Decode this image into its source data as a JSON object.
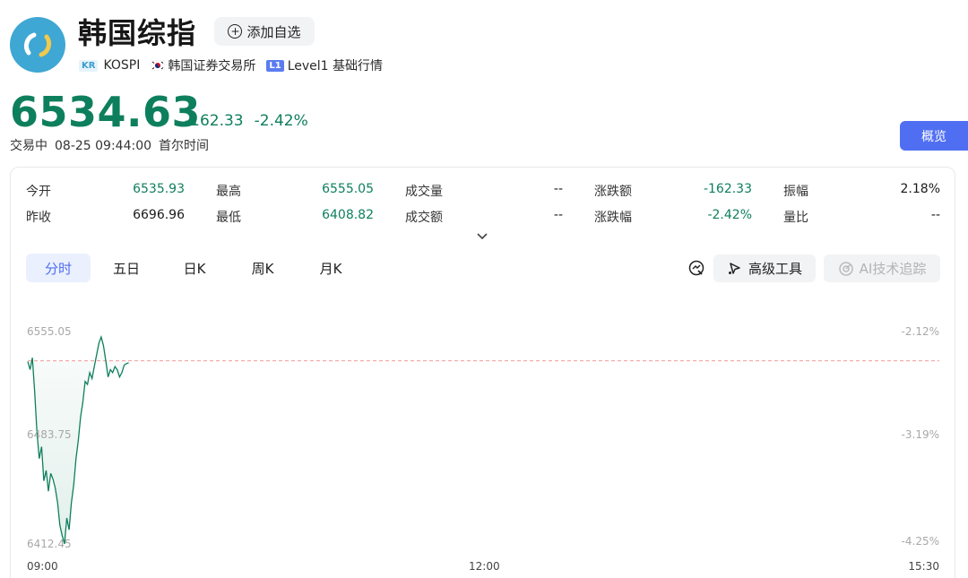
{
  "header": {
    "title": "韩国综指",
    "add_watchlist_label": "添加自选",
    "market_badge": "KR",
    "symbol": "KOSPI",
    "exchange": "韩国证券交易所",
    "level_badge": "L1",
    "level_label": "Level1 基础行情"
  },
  "quote": {
    "price": "6534.63",
    "change": "-162.33",
    "change_pct": "-2.42%",
    "status": "交易中",
    "datetime": "08-25 09:44:00",
    "timezone": "首尔时间",
    "color": "#0e7f5d"
  },
  "overview_button": "概览",
  "stats": {
    "rows": [
      [
        {
          "label": "今开",
          "value": "6535.93",
          "tone": "green"
        },
        {
          "label": "最高",
          "value": "6555.05",
          "tone": "green"
        },
        {
          "label": "成交量",
          "value": "--",
          "tone": "dark"
        },
        {
          "label": "涨跌额",
          "value": "-162.33",
          "tone": "green"
        },
        {
          "label": "振幅",
          "value": "2.18%",
          "tone": "dark"
        }
      ],
      [
        {
          "label": "昨收",
          "value": "6696.96",
          "tone": "dark"
        },
        {
          "label": "最低",
          "value": "6408.82",
          "tone": "green"
        },
        {
          "label": "成交额",
          "value": "--",
          "tone": "dark"
        },
        {
          "label": "涨跌幅",
          "value": "-2.42%",
          "tone": "green"
        },
        {
          "label": "量比",
          "value": "--",
          "tone": "dark"
        }
      ]
    ]
  },
  "tabs": [
    "分时",
    "五日",
    "日K",
    "周K",
    "月K"
  ],
  "active_tab": 0,
  "tools": {
    "advanced_label": "高级工具",
    "ai_label": "AI技术追踪"
  },
  "chart_data": {
    "type": "line",
    "title": "",
    "xlabel": "",
    "ylabel": "",
    "x_ticks": [
      "09:00",
      "12:00",
      "15:30"
    ],
    "y_ticks_left": [
      "6555.05",
      "6483.75",
      "6412.45"
    ],
    "y_ticks_right": [
      "-2.12%",
      "-3.19%",
      "-4.25%"
    ],
    "ylim": [
      6412.45,
      6555.05
    ],
    "prev_close_line": 6535.93,
    "series": [
      {
        "color": "#0e7f5d",
        "minutes": [
          0,
          1,
          2,
          3,
          4,
          5,
          6,
          7,
          8,
          9,
          10,
          11,
          12,
          13,
          14,
          15,
          16,
          17,
          18,
          19,
          20,
          21,
          22,
          23,
          24,
          25,
          26,
          27,
          28,
          29,
          30,
          31,
          32,
          33,
          34,
          35,
          36,
          37,
          38,
          39,
          40,
          41,
          42,
          43,
          44
        ],
        "values": [
          6535.5,
          6530.0,
          6538.0,
          6515.0,
          6488.0,
          6470.0,
          6478.0,
          6455.0,
          6462.0,
          6448.0,
          6460.0,
          6456.0,
          6450.0,
          6440.0,
          6425.0,
          6418.0,
          6412.5,
          6430.0,
          6422.0,
          6440.0,
          6452.0,
          6470.0,
          6482.0,
          6498.0,
          6508.0,
          6522.0,
          6520.0,
          6528.0,
          6524.0,
          6532.0,
          6540.0,
          6548.0,
          6552.0,
          6546.0,
          6536.0,
          6525.0,
          6530.0,
          6528.0,
          6532.0,
          6530.0,
          6525.0,
          6528.0,
          6533.0,
          6534.0,
          6534.6
        ]
      }
    ]
  }
}
